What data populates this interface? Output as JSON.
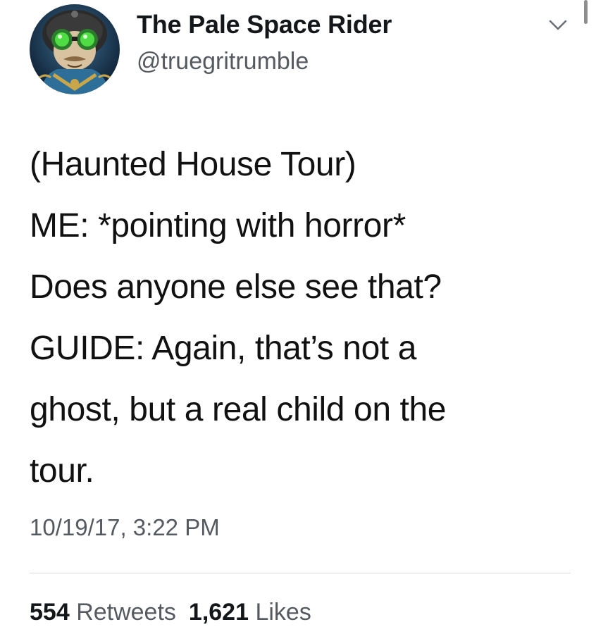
{
  "tweet": {
    "author": {
      "display_name": "The Pale Space Rider",
      "handle": "@truegritrumble",
      "avatar_icon": "cartoon-goggles-avatar"
    },
    "menu_icon": "chevron-down-icon",
    "text_lines": [
      "(Haunted House Tour)",
      "ME: *pointing with horror*",
      "Does anyone else see that?",
      "GUIDE: Again, that’s not a",
      "ghost, but a real child on the",
      "tour."
    ],
    "timestamp": "10/19/17, 3:22 PM",
    "stats": {
      "retweets_count": "554",
      "retweets_label": "Retweets",
      "likes_count": "1,621",
      "likes_label": "Likes"
    }
  },
  "colors": {
    "text": "#111111",
    "secondary": "#555a60",
    "divider": "#d7dade",
    "avatar_bg": "#1e3a5c",
    "goggles": "#3fc63a"
  }
}
